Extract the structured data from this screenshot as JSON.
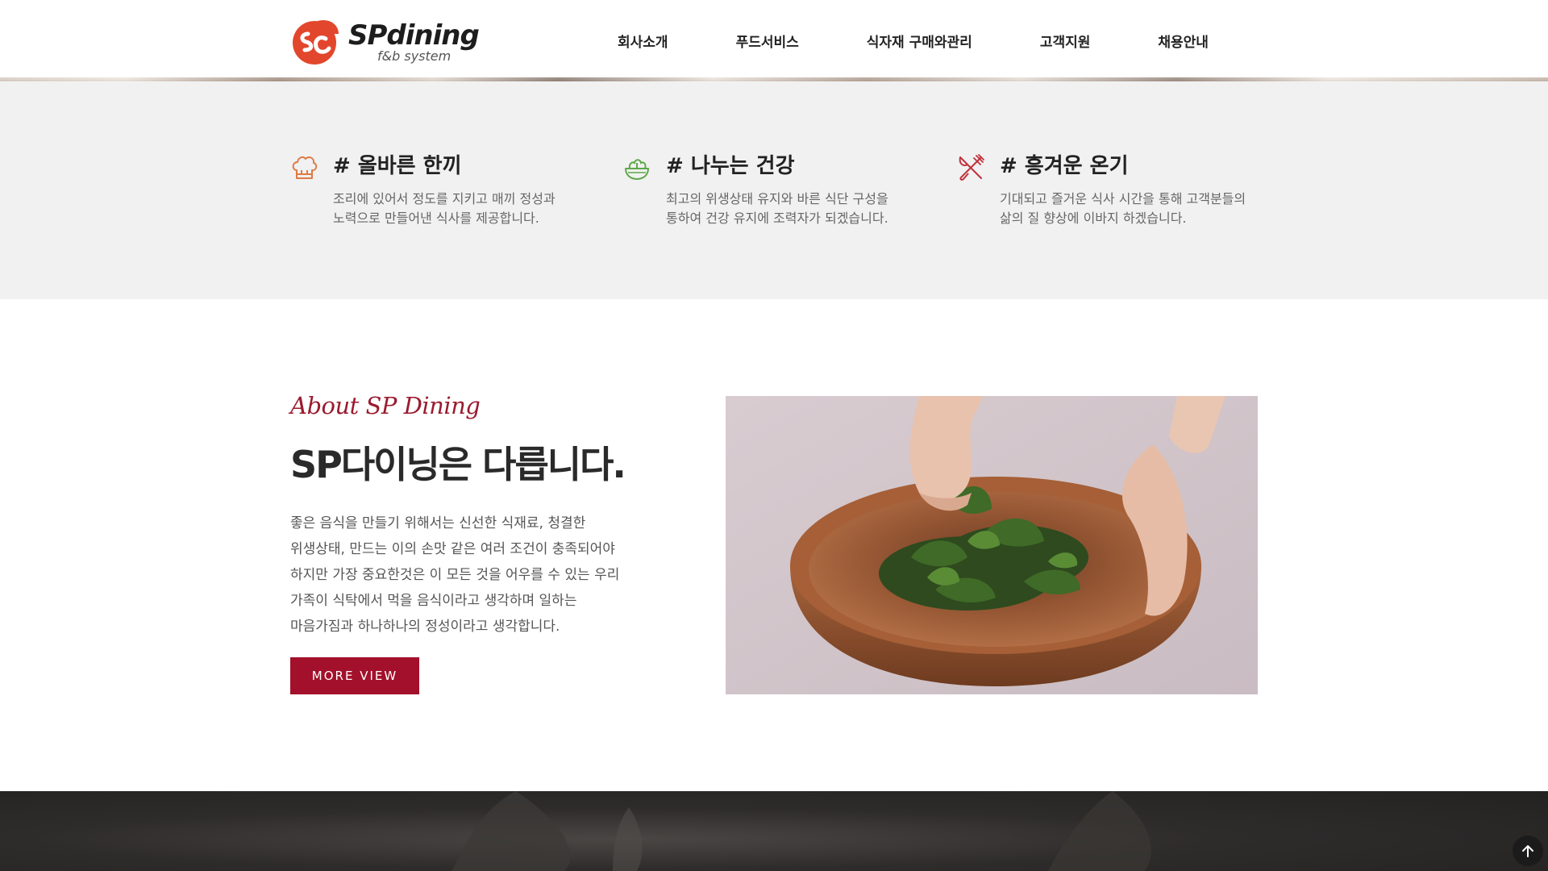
{
  "header": {
    "logo_text": "SPdining",
    "logo_sub": "f&b system",
    "nav": [
      "회사소개",
      "푸드서비스",
      "식자재 구매와관리",
      "고객지원",
      "채용안내"
    ]
  },
  "features": [
    {
      "icon": "chef-hat-icon",
      "title": "# 올바른 한끼",
      "desc": [
        "조리에 있어서 정도를 지키고 매끼 정성과",
        "노력으로 만들어낸 식사를 제공합니다."
      ],
      "icon_color": "#e07a43"
    },
    {
      "icon": "salad-bowl-icon",
      "title": "# 나누는 건강",
      "desc": [
        "최고의 위생상태 유지와 바른 식단 구성을",
        "통하여 건강 유지에 조력자가 되겠습니다."
      ],
      "icon_color": "#5ea84a"
    },
    {
      "icon": "fork-knife-icon",
      "title": "# 흥겨운 온기",
      "desc": [
        "기대되고 즐거운 식사 시간을 통해 고객분들의",
        "삶의 질 향상에 이바지 하겠습니다."
      ],
      "icon_color": "#c0323c"
    }
  ],
  "about": {
    "eyebrow": "About SP Dining",
    "title": "SP다이닝은 다릅니다.",
    "body": [
      "좋은 음식을 만들기 위해서는 신선한 식재료, 청결한",
      "위생상태, 만드는 이의 손맛 같은 여러 조건이 충족되어야",
      "하지만 가장 중요한것은 이 모든 것을 어우를 수 있는 우리",
      "가족이 식탁에서 먹을 음식이라고 생각하며 일하는",
      "마음가짐과 하나하나의 정성이라고 생각합니다."
    ],
    "button_label": "MORE VIEW"
  },
  "colors": {
    "accent": "#a3102b",
    "features_bg": "#f1f1f1"
  }
}
